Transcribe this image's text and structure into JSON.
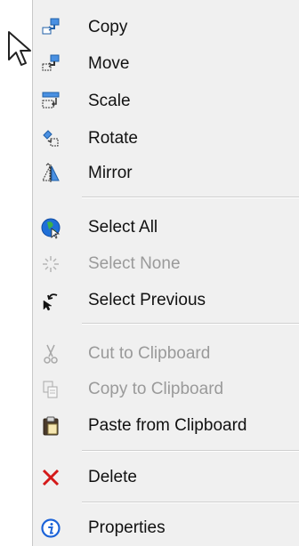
{
  "menu": {
    "items": {
      "copy": {
        "label": "Copy",
        "icon": "copy-icon",
        "enabled": true
      },
      "move": {
        "label": "Move",
        "icon": "move-icon",
        "enabled": true
      },
      "scale": {
        "label": "Scale",
        "icon": "scale-icon",
        "enabled": true
      },
      "rotate": {
        "label": "Rotate",
        "icon": "rotate-icon",
        "enabled": true
      },
      "mirror": {
        "label": "Mirror",
        "icon": "mirror-icon",
        "enabled": true
      },
      "select_all": {
        "label": "Select All",
        "icon": "select-all-icon",
        "enabled": true
      },
      "select_none": {
        "label": "Select None",
        "icon": "select-none-icon",
        "enabled": false
      },
      "select_previous": {
        "label": "Select Previous",
        "icon": "select-previous-icon",
        "enabled": true
      },
      "cut_clipboard": {
        "label": "Cut to Clipboard",
        "icon": "scissors-icon",
        "enabled": false
      },
      "copy_clipboard": {
        "label": "Copy to Clipboard",
        "icon": "copy-clipboard-icon",
        "enabled": false
      },
      "paste_clipboard": {
        "label": "Paste from Clipboard",
        "icon": "paste-icon",
        "enabled": true
      },
      "delete": {
        "label": "Delete",
        "icon": "delete-x-icon",
        "enabled": true
      },
      "properties": {
        "label": "Properties",
        "icon": "info-icon",
        "enabled": true
      }
    }
  },
  "colors": {
    "menu_background": "#f0f0f0",
    "text": "#111111",
    "disabled_text": "#9a9a9a",
    "separator": "#cfcfcf",
    "delete_red": "#d41919",
    "info_blue": "#1c63d8"
  }
}
